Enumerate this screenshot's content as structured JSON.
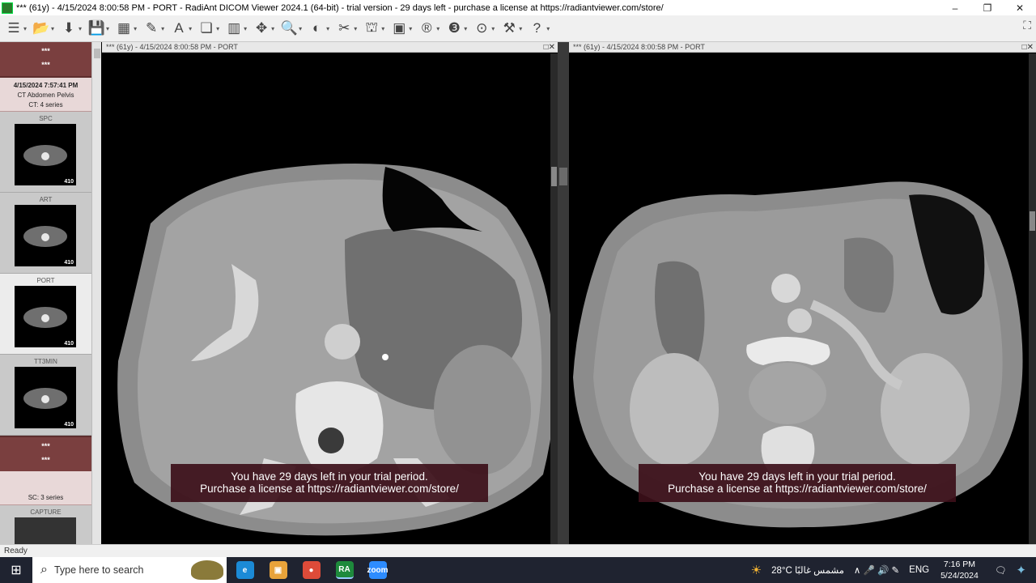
{
  "window": {
    "title": "*** (61y) - 4/15/2024 8:00:58 PM - PORT - RadiAnt DICOM Viewer 2024.1 (64-bit) - trial version - 29 days left - purchase a license at https://radiantviewer.com/store/",
    "minimize": "–",
    "restore": "❐",
    "close": "✕"
  },
  "toolbar": {
    "icons": [
      "menu-icon",
      "open-folder-icon",
      "download-icon",
      "save-icon",
      "layout-icon",
      "pen-icon",
      "text-icon",
      "copy-icon",
      "series-icon",
      "move-icon",
      "zoom-icon",
      "window-level-icon",
      "measure-icon",
      "3d-mpr-icon",
      "film-icon",
      "r-icon",
      "3d-icon",
      "fusion-icon",
      "tools-icon",
      "help-icon"
    ],
    "glyphs": [
      "☰",
      "📂",
      "⬇",
      "💾",
      "▦",
      "✎",
      "A",
      "❏",
      "▥",
      "✥",
      "🔍",
      "◐",
      "✂",
      "⛫",
      "▣",
      "®",
      "❸",
      "⊙",
      "⚒",
      "?"
    ],
    "fullscreen": "⛶"
  },
  "sidebar": {
    "patient": {
      "name": "***",
      "id": "***"
    },
    "study": {
      "date": "4/15/2024 7:57:41 PM",
      "description": "CT Abdomen  Pelvis",
      "series_count": "CT: 4 series"
    },
    "series": [
      {
        "label": "SPC",
        "count": "410"
      },
      {
        "label": "ART",
        "count": "410"
      },
      {
        "label": "PORT",
        "count": "410"
      },
      {
        "label": "TT3MIN",
        "count": "410"
      }
    ],
    "patient2": {
      "name": "***",
      "id": "***"
    },
    "study2": {
      "series_count": "SC: 3 series"
    },
    "capture": {
      "label": "CAPTURE"
    }
  },
  "viewports": [
    {
      "header": "*** (61y) - 4/15/2024 8:00:58 PM - PORT",
      "buttons": "□✕",
      "trial_line1": "You have 29 days left in your trial period.",
      "trial_line2": "Purchase a license at https://radiantviewer.com/store/"
    },
    {
      "header": "*** (61y) - 4/15/2024 8:00:58 PM - PORT",
      "buttons": "□✕",
      "trial_line1": "You have 29 days left in your trial period.",
      "trial_line2": "Purchase a license at https://radiantviewer.com/store/"
    }
  ],
  "status": {
    "text": "Ready"
  },
  "taskbar": {
    "start_glyph": "⊞",
    "search_icon": "⌕",
    "search_placeholder": "Type here to search",
    "apps": [
      {
        "name": "edge",
        "glyph": "e",
        "color": "#1b8ad6"
      },
      {
        "name": "store",
        "glyph": "▣",
        "color": "#e8a33a"
      },
      {
        "name": "chrome",
        "glyph": "●",
        "color": "#dd4b39"
      },
      {
        "name": "radiant",
        "glyph": "RA",
        "color": "#1e8a3c"
      },
      {
        "name": "zoom",
        "glyph": "zoom",
        "color": "#2d8cff"
      }
    ],
    "weather": "28°C  مشمس غالبًا",
    "weather_icon": "☀",
    "tray_icons": "∧  🎤  🔊  ✎",
    "language": "ENG",
    "time": "7:16 PM",
    "date": "5/24/2024",
    "notification_icon": "🗨",
    "copilot_icon": "✦"
  }
}
